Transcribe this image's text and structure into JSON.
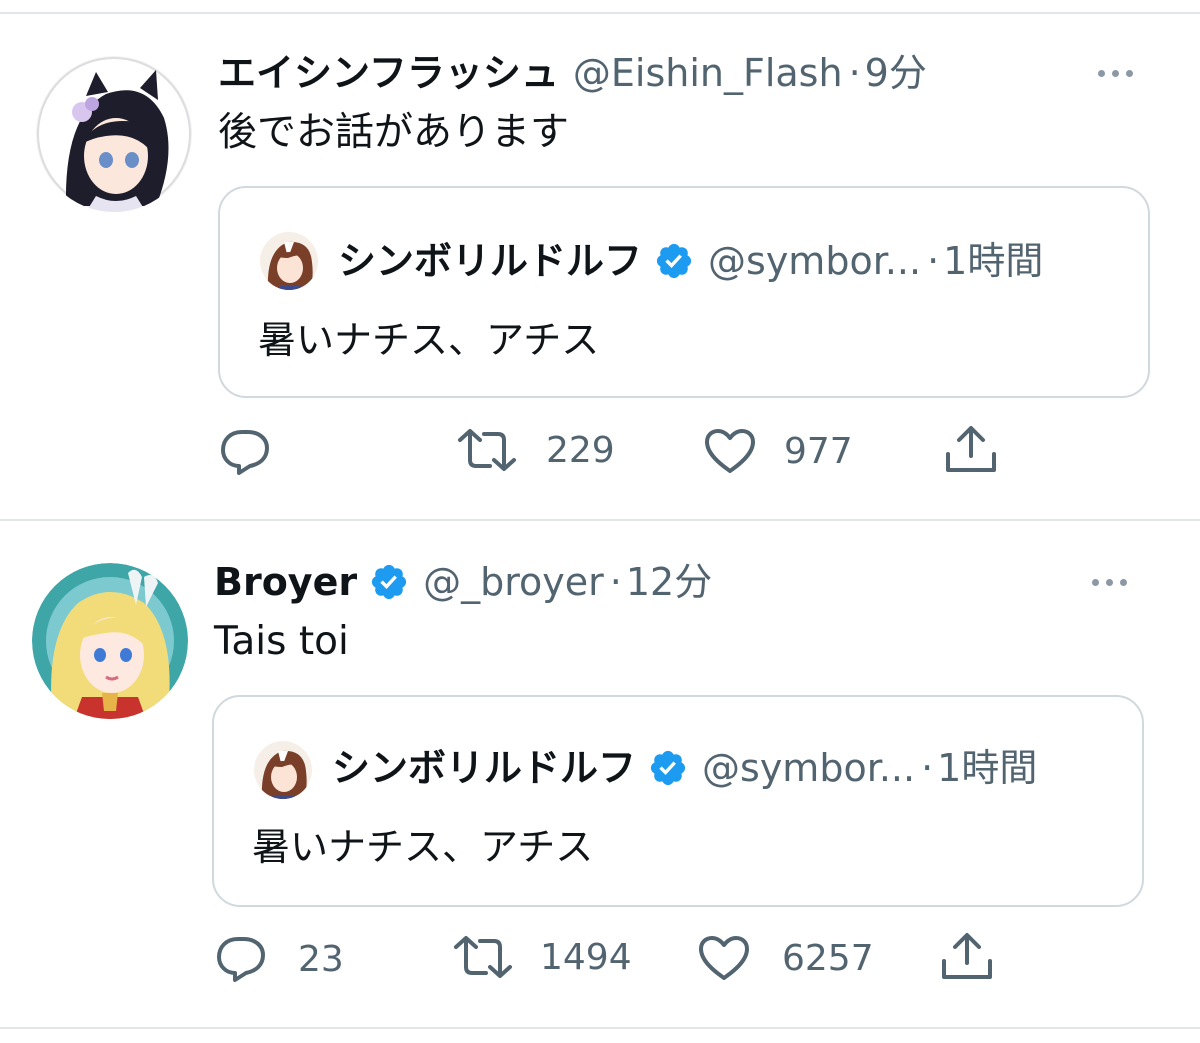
{
  "colors": {
    "text": "#0f1419",
    "secondary": "#536471",
    "verified": "#1d9bf0",
    "border": "#cfd9de",
    "divider": "#e3e6e8"
  },
  "tweets": [
    {
      "display_name": "エイシンフラッシュ",
      "handle": "@Eishin_Flash",
      "separator": "·",
      "time": "9分",
      "verified": false,
      "text": "後でお話があります",
      "quote": {
        "display_name": "シンボリルドルフ",
        "handle": "@symbor...",
        "separator": "·",
        "time": "1時間",
        "verified": true,
        "text": "暑いナチス、アチス"
      },
      "actions": {
        "reply": "",
        "retweet": "229",
        "like": "977"
      },
      "icons": [
        "reply-icon",
        "retweet-icon",
        "like-icon",
        "share-icon",
        "more-icon"
      ]
    },
    {
      "display_name": "Broyer",
      "handle": "@_broyer",
      "separator": "·",
      "time": "12分",
      "verified": true,
      "text": "Tais toi",
      "quote": {
        "display_name": "シンボリルドルフ",
        "handle": "@symbor...",
        "separator": "·",
        "time": "1時間",
        "verified": true,
        "text": "暑いナチス、アチス"
      },
      "actions": {
        "reply": "23",
        "retweet": "1494",
        "like": "6257"
      },
      "icons": [
        "reply-icon",
        "retweet-icon",
        "like-icon",
        "share-icon",
        "more-icon"
      ]
    }
  ]
}
